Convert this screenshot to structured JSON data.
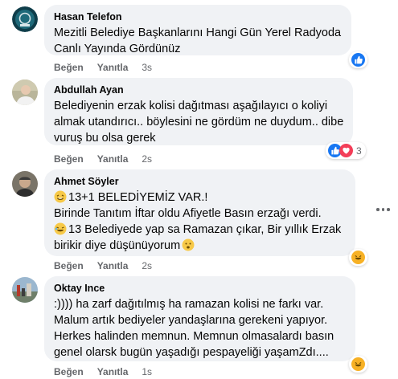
{
  "comments": [
    {
      "author": "Hasan Telefon",
      "lines": [
        "Mezitli Belediye Başkanlarını Hangi Gün Yerel Radyoda",
        "Canlı Yayında Gördünüz"
      ],
      "like_label": "Beğen",
      "reply_label": "Yanıtla",
      "time": "3s",
      "reactions": [
        "like-icon"
      ],
      "reaction_count": ""
    },
    {
      "author": "Abdullah Ayan",
      "lines": [
        "Belediyenin erzak kolisi dağıtması aşağılayıcı o koliyi",
        "almak utandırıcı.. böylesini ne gördüm ne duydum.. dibe",
        "vuruş bu olsa gerek"
      ],
      "like_label": "Beğen",
      "reply_label": "Yanıtla",
      "time": "2s",
      "reactions": [
        "like-icon",
        "love-icon"
      ],
      "reaction_count": "3"
    },
    {
      "author": "Ahmet Söyler",
      "lines": [
        "13+1 BELEDİYEMİZ VAR.!",
        "Birinde Tanıtım İftar oldu Afiyetle Basın erzağı verdi.",
        "13 Belediyede yap sa Ramazan çıkar, Bir yıllık Erzak",
        "birikir diye düşünüyorum"
      ],
      "like_label": "Beğen",
      "reply_label": "Yanıtla",
      "time": "2s",
      "reactions": [
        "haha-icon"
      ],
      "reaction_count": ""
    },
    {
      "author": "Oktay Ince",
      "lines": [
        ":))))  ha zarf dağıtılmış ha ramazan kolisi ne farkı var.",
        "Malum artık bediyeler yandaşlarına gerekeni yapıyor.",
        "Herkes halinden memnun. Memnun olmasalardı basın",
        "genel olarsk bugün yaşadığı pespayeliği yaşamZdı...."
      ],
      "like_label": "Beğen",
      "reply_label": "Yanıtla",
      "time": "1s",
      "reactions": [
        "haha-icon"
      ],
      "reaction_count": ""
    }
  ],
  "colors": {
    "bubble": "#f0f2f5",
    "meta": "#65676b",
    "like": "#1877f2",
    "love": "#f33e58",
    "haha": "#f7b125"
  }
}
